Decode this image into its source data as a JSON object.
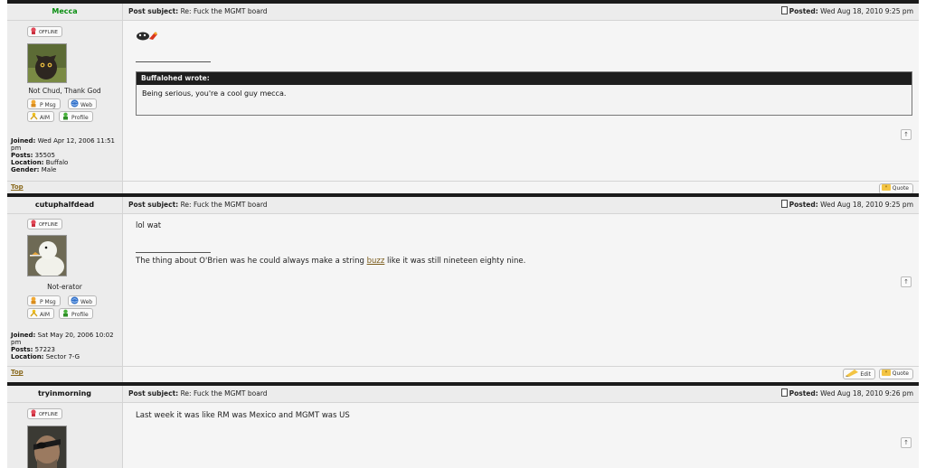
{
  "top_link": "Top",
  "posts": [
    {
      "author": "Mecca",
      "status": "OFFLINE",
      "title": "Not Chud, Thank God",
      "subject_label": "Post subject:",
      "subject": "Re: Fuck the MGMT board",
      "posted_label": "Posted:",
      "posted": "Wed Aug 18, 2010 9:25 pm",
      "buttons": {
        "pm": "P Msg",
        "web": "Web",
        "aim": "AIM",
        "profile": "Profile",
        "quote": "Quote"
      },
      "joined_label": "Joined:",
      "joined": "Wed Apr 12, 2006 11:51 pm",
      "posts_label": "Posts:",
      "posts": "35505",
      "location_label": "Location:",
      "location": "Buffalo",
      "gender_label": "Gender:",
      "gender": "Male",
      "quote_author": "Buffalohed wrote:",
      "quote_text": "Being serious, you're a cool guy mecca."
    },
    {
      "author": "cutuphalfdead",
      "status": "OFFLINE",
      "title": "Not-erator",
      "subject_label": "Post subject:",
      "subject": "Re: Fuck the MGMT board",
      "posted_label": "Posted:",
      "posted": "Wed Aug 18, 2010 9:25 pm",
      "buttons": {
        "pm": "P Msg",
        "web": "Web",
        "aim": "AIM",
        "profile": "Profile",
        "edit": "Edit",
        "quote": "Quote"
      },
      "joined_label": "Joined:",
      "joined": "Sat May 20, 2006 10:02 pm",
      "posts_label": "Posts:",
      "posts": "57223",
      "location_label": "Location:",
      "location": "Sector 7-G",
      "message": "lol wat",
      "signature_before": "The thing about O'Brien was he could always make a string",
      "signature_link": "buzz",
      "signature_after": "like it was still nineteen eighty nine."
    },
    {
      "author": "tryinmorning",
      "status": "OFFLINE",
      "subject_label": "Post subject:",
      "subject": "Re: Fuck the MGMT board",
      "posted_label": "Posted:",
      "posted": "Wed Aug 18, 2010 9:26 pm",
      "message": "Last week it was like RM was Mexico and MGMT was US"
    }
  ]
}
